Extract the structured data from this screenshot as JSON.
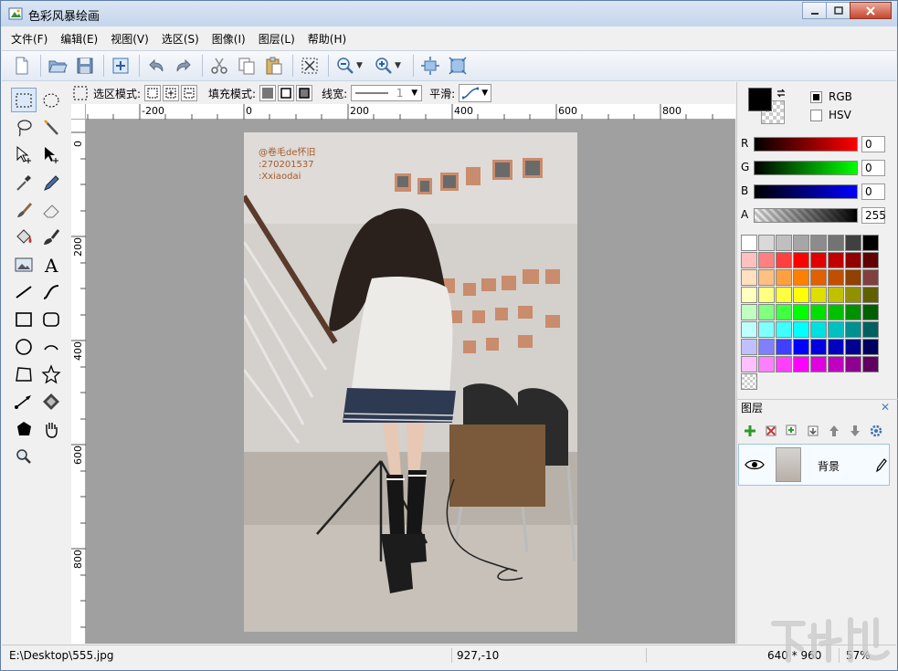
{
  "window": {
    "title": "色彩风暴绘画"
  },
  "menu": [
    "文件(F)",
    "编辑(E)",
    "视图(V)",
    "选区(S)",
    "图像(I)",
    "图层(L)",
    "帮助(H)"
  ],
  "options": {
    "select_mode_label": "选区模式:",
    "fill_mode_label": "填充模式:",
    "line_width_label": "线宽:",
    "line_width_value": "1",
    "smooth_label": "平滑:"
  },
  "ruler": {
    "h_ticks": [
      "-200",
      "0",
      "200",
      "400",
      "600",
      "800"
    ],
    "v_ticks": [
      "0",
      "200",
      "400",
      "600",
      "800"
    ]
  },
  "photo": {
    "watermark_lines": [
      "@卷毛de怀旧",
      ":270201537",
      ":Xxiaodai"
    ]
  },
  "color": {
    "mode_rgb": "RGB",
    "mode_hsv": "HSV",
    "mode_selected": "RGB",
    "channels": [
      {
        "name": "R",
        "value": "0",
        "color": "#ff0000"
      },
      {
        "name": "G",
        "value": "0",
        "color": "#00ff00"
      },
      {
        "name": "B",
        "value": "0",
        "color": "#0000ff"
      },
      {
        "name": "A",
        "value": "255",
        "color": "#000000"
      }
    ],
    "palette": [
      "#ffffff",
      "#d9d9d9",
      "#bfbfbf",
      "#a6a6a6",
      "#8c8c8c",
      "#737373",
      "#404040",
      "#000000",
      "#ffc0c0",
      "#ff8080",
      "#ff4040",
      "#ff0000",
      "#e00000",
      "#c00000",
      "#900000",
      "#600000",
      "#ffe0c0",
      "#ffc080",
      "#ffa040",
      "#ff8000",
      "#e06000",
      "#c05000",
      "#904000",
      "#804040",
      "#ffffc0",
      "#ffff80",
      "#ffff40",
      "#ffff00",
      "#e0e000",
      "#c0c000",
      "#909000",
      "#606000",
      "#c0ffc0",
      "#80ff80",
      "#40ff40",
      "#00ff00",
      "#00e000",
      "#00c000",
      "#009000",
      "#006000",
      "#c0ffff",
      "#80ffff",
      "#40ffff",
      "#00ffff",
      "#00e0e0",
      "#00c0c0",
      "#009090",
      "#006060",
      "#c0c0ff",
      "#8080ff",
      "#4040ff",
      "#0000ff",
      "#0000e0",
      "#0000c0",
      "#000090",
      "#000060",
      "#ffc0ff",
      "#ff80ff",
      "#ff40ff",
      "#ff00ff",
      "#e000e0",
      "#c000c0",
      "#900090",
      "#600060"
    ]
  },
  "layers": {
    "header": "图层",
    "items": [
      {
        "name": "背景",
        "visible": true
      }
    ]
  },
  "status": {
    "path": "E:\\Desktop\\555.jpg",
    "coords": "927,-10",
    "size": "640 * 960",
    "zoom": "57%"
  }
}
